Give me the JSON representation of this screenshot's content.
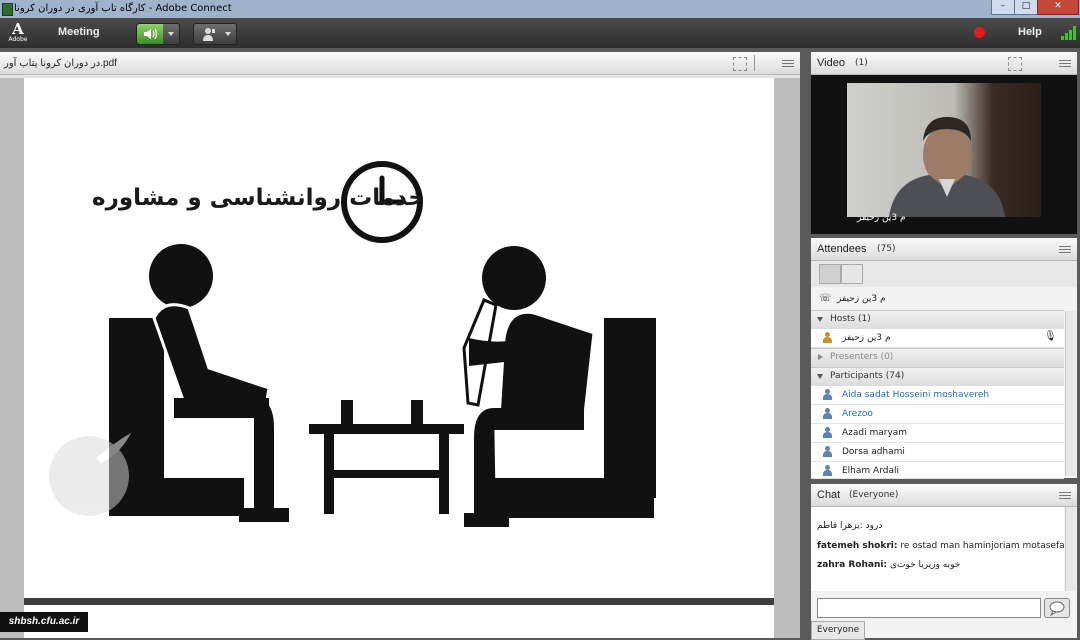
{
  "window": {
    "title": "کارگاه تاب آوری در دوران کرونا - Adobe Connect",
    "controls": [
      "–",
      "□",
      "✕"
    ]
  },
  "menubar": {
    "logo_letter": "A",
    "logo_text": "Adobe",
    "meeting_label": "Meeting",
    "help_label": "Help"
  },
  "share": {
    "filename": "در دوران کرونا یتاب آور.pdf",
    "slide_heading": "خدمات روانشناسی و مشاوره",
    "watermark": "shbsh.cfu.ac.ir"
  },
  "video": {
    "title": "Video",
    "count": "(1)",
    "speaker_name": "م 3ین زحیفز"
  },
  "attendees": {
    "title": "Attendees",
    "count": "(75)",
    "me_name": "م 3ین زحیفز",
    "hosts_label": "Hosts (1)",
    "host_name": "م 3ین زحیفز",
    "presenters_label": "Presenters (0)",
    "participants_label": "Participants (74)",
    "participants": [
      {
        "name": "Aida sadat Hosseini moshavereh"
      },
      {
        "name": "Arezoo"
      },
      {
        "name": "Azadi maryam"
      },
      {
        "name": "Dorsa adhami"
      },
      {
        "name": "Elham Ardali"
      }
    ]
  },
  "chat": {
    "title": "Chat",
    "scope": "(Everyone)",
    "messages": [
      {
        "sender": "",
        "text": "درود :یزهرا فاطم"
      },
      {
        "sender": "fatemeh shokri:",
        "text": "re ostad man haminjoriam motasefane"
      },
      {
        "sender": "zahra Rohani:",
        "text": "خوبه وزیریا خوت‌ی"
      }
    ],
    "input_value": "",
    "recipient_tab": "Everyone"
  },
  "colors": {
    "speaker_on": "#4aa82c",
    "record": "#e21b1b",
    "signal": "#43c02a",
    "participant_link": "#1d6fc4"
  }
}
